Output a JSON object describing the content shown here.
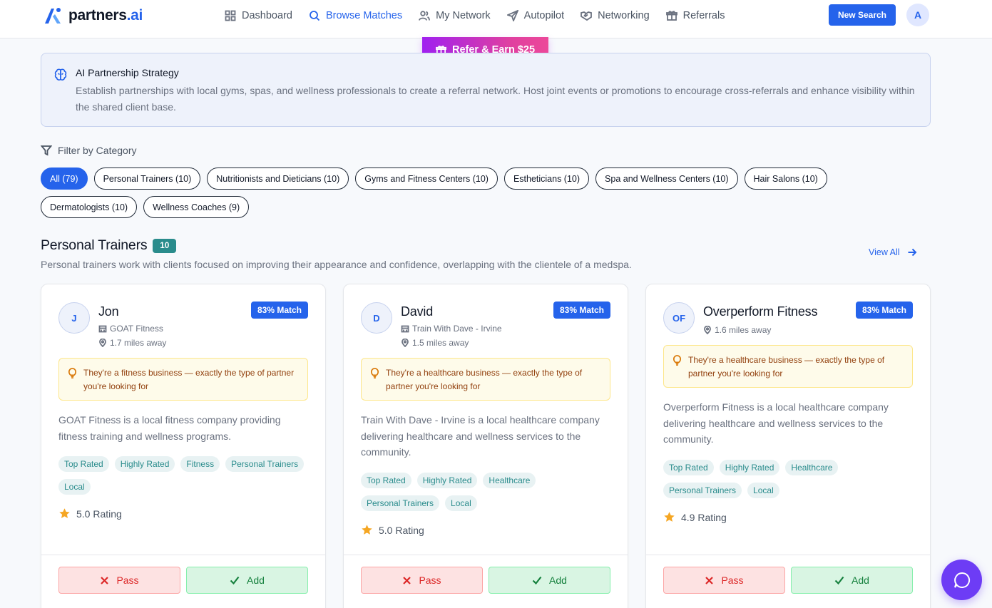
{
  "brand": {
    "name_main": "partners",
    "name_suffix": ".ai",
    "accent": "#2563eb"
  },
  "nav": [
    {
      "label": "Dashboard",
      "icon": "grid-icon",
      "active": false
    },
    {
      "label": "Browse Matches",
      "icon": "search-icon",
      "active": true
    },
    {
      "label": "My Network",
      "icon": "users-icon",
      "active": false
    },
    {
      "label": "Autopilot",
      "icon": "send-icon",
      "active": false
    },
    {
      "label": "Networking",
      "icon": "handshake-icon",
      "active": false
    },
    {
      "label": "Referrals",
      "icon": "gift-icon",
      "active": false
    }
  ],
  "header": {
    "new_search_label": "New Search",
    "avatar_initial": "A"
  },
  "refer": {
    "label": "Refer & Earn $25"
  },
  "strategy": {
    "title": "AI Partnership Strategy",
    "text": "Establish partnerships with local gyms, spas, and wellness professionals to create a referral network. Host joint events or promotions to encourage cross-referrals and enhance visibility within the shared client base."
  },
  "filter": {
    "label": "Filter by Category",
    "chips": [
      {
        "label": "All (79)",
        "active": true
      },
      {
        "label": "Personal Trainers (10)",
        "active": false
      },
      {
        "label": "Nutritionists and Dieticians (10)",
        "active": false
      },
      {
        "label": "Gyms and Fitness Centers (10)",
        "active": false
      },
      {
        "label": "Estheticians (10)",
        "active": false
      },
      {
        "label": "Spa and Wellness Centers (10)",
        "active": false
      },
      {
        "label": "Hair Salons (10)",
        "active": false
      },
      {
        "label": "Dermatologists (10)",
        "active": false
      },
      {
        "label": "Wellness Coaches (9)",
        "active": false
      }
    ]
  },
  "section": {
    "title": "Personal Trainers",
    "count": "10",
    "description": "Personal trainers work with clients focused on improving their appearance and confidence, overlapping with the clientele of a medspa.",
    "view_all_label": "View All"
  },
  "cards": [
    {
      "initials": "J",
      "name": "Jon",
      "business": "GOAT Fitness",
      "distance": "1.7 miles away",
      "match": "83% Match",
      "tip": "They're a fitness business — exactly the type of partner you're looking for",
      "description": "GOAT Fitness is a local fitness company providing fitness training and wellness programs.",
      "tags": [
        "Top Rated",
        "Highly Rated",
        "Fitness",
        "Personal Trainers",
        "Local"
      ],
      "rating": "5.0 Rating",
      "pass_label": "Pass",
      "add_label": "Add"
    },
    {
      "initials": "D",
      "name": "David",
      "business": "Train With Dave - Irvine",
      "distance": "1.5 miles away",
      "match": "83% Match",
      "tip": "They're a healthcare business — exactly the type of partner you're looking for",
      "description": "Train With Dave - Irvine is a local healthcare company delivering healthcare and wellness services to the community.",
      "tags": [
        "Top Rated",
        "Highly Rated",
        "Healthcare",
        "Personal Trainers",
        "Local"
      ],
      "rating": "5.0 Rating",
      "pass_label": "Pass",
      "add_label": "Add"
    },
    {
      "initials": "OF",
      "name": "Overperform Fitness",
      "business": "",
      "distance": "1.6 miles away",
      "match": "83% Match",
      "tip": "They're a healthcare business — exactly the type of partner you're looking for",
      "description": "Overperform Fitness is a local healthcare company delivering healthcare and wellness services to the community.",
      "tags": [
        "Top Rated",
        "Highly Rated",
        "Healthcare",
        "Personal Trainers",
        "Local"
      ],
      "rating": "4.9 Rating",
      "pass_label": "Pass",
      "add_label": "Add"
    }
  ]
}
